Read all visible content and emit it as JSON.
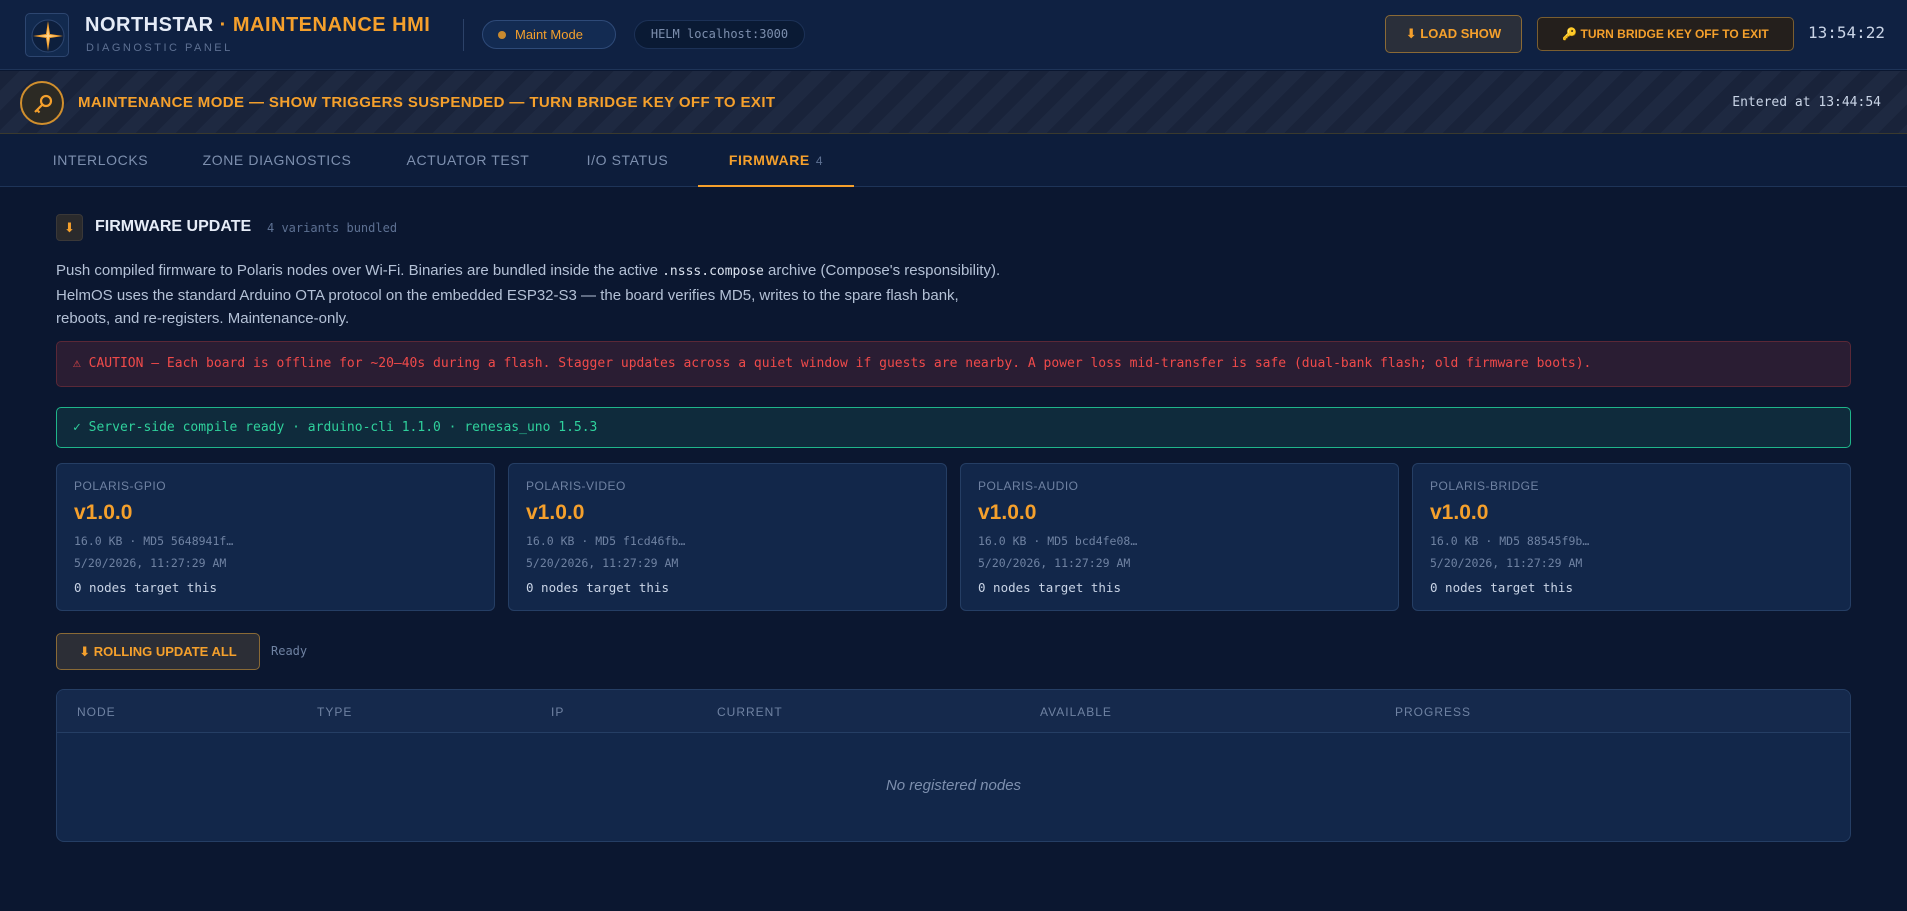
{
  "header": {
    "brand": "NORTHSTAR",
    "brand_accent": "· MAINTENANCE HMI",
    "subtitle": "DIAGNOSTIC PANEL",
    "mode_pill": "Maint Mode",
    "helm_pill": "HELM localhost:3000",
    "load_button": "⬇ LOAD SHOW",
    "bridge_button": "🔑 TURN BRIDGE KEY OFF TO EXIT",
    "clock": "13:54:22",
    "logo_icon": "compass-star-icon"
  },
  "banner": {
    "text": "MAINTENANCE MODE — SHOW TRIGGERS SUSPENDED — TURN BRIDGE KEY OFF TO EXIT",
    "entered": "Entered at 13:44:54",
    "icon": "key-icon"
  },
  "tabs": [
    {
      "label": "INTERLOCKS"
    },
    {
      "label": "ZONE DIAGNOSTICS"
    },
    {
      "label": "ACTUATOR TEST"
    },
    {
      "label": "I/O STATUS"
    },
    {
      "label": "FIRMWARE",
      "count": "4",
      "active": true
    }
  ],
  "section": {
    "icon": "⬇",
    "title": "FIRMWARE UPDATE",
    "subtitle": "4 variants bundled",
    "desc_1": "Push compiled firmware to Polaris nodes over Wi-Fi. Binaries are bundled inside the active ",
    "desc_code": ".nsss.compose",
    "desc_2": " archive (Compose's responsibility). HelmOS uses the standard Arduino OTA protocol on the embedded ESP32-S3 — the board verifies MD5, writes to the spare flash bank, reboots, and re-registers. Maintenance-only."
  },
  "caution": "⚠ CAUTION — Each board is offline for ~20–40s during a flash. Stagger updates across a quiet window if guests are nearby. A power loss mid-transfer is safe (dual-bank flash; old firmware boots).",
  "compile_status": "✓ Server-side compile ready · arduino-cli 1.1.0 · renesas_uno 1.5.3",
  "firmware": [
    {
      "name": "POLARIS-GPIO",
      "version": "v1.0.0",
      "meta": "16.0 KB · MD5 5648941f…",
      "date": "5/20/2026, 11:27:29 AM",
      "targets": "0 nodes target this"
    },
    {
      "name": "POLARIS-VIDEO",
      "version": "v1.0.0",
      "meta": "16.0 KB · MD5 f1cd46fb…",
      "date": "5/20/2026, 11:27:29 AM",
      "targets": "0 nodes target this"
    },
    {
      "name": "POLARIS-AUDIO",
      "version": "v1.0.0",
      "meta": "16.0 KB · MD5 bcd4fe08…",
      "date": "5/20/2026, 11:27:29 AM",
      "targets": "0 nodes target this"
    },
    {
      "name": "POLARIS-BRIDGE",
      "version": "v1.0.0",
      "meta": "16.0 KB · MD5 88545f9b…",
      "date": "5/20/2026, 11:27:29 AM",
      "targets": "0 nodes target this"
    }
  ],
  "rolling": {
    "button": "⬇ ROLLING UPDATE ALL",
    "status": "Ready"
  },
  "table": {
    "columns": [
      "NODE",
      "TYPE",
      "IP",
      "CURRENT",
      "AVAILABLE",
      "PROGRESS"
    ],
    "empty": "No registered nodes"
  },
  "colors": {
    "accent": "#f5a02c",
    "background": "#0b1730",
    "caution": "#f04a4a",
    "ok": "#2fd19c"
  }
}
